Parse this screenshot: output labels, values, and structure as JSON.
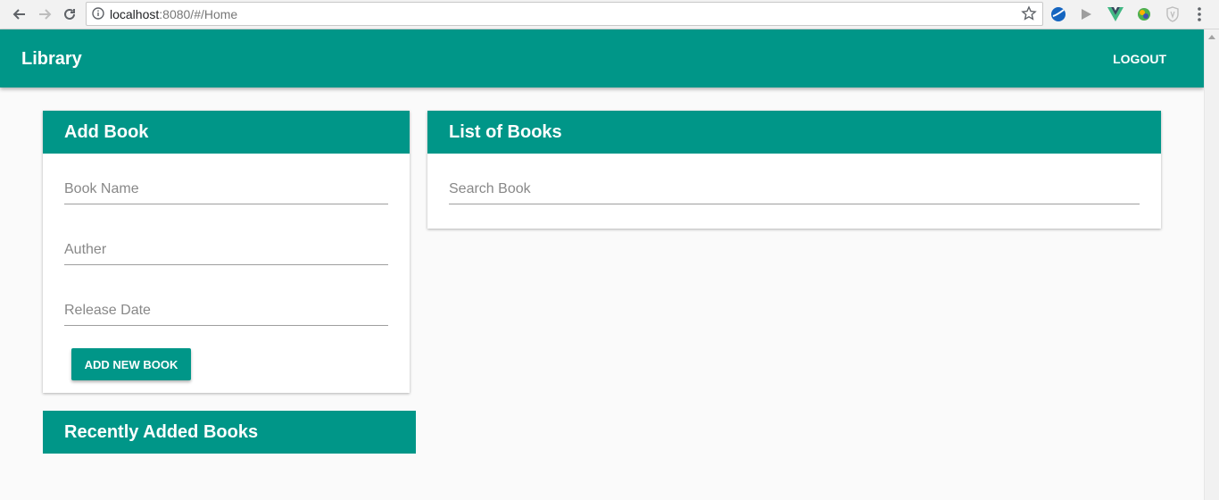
{
  "browser": {
    "url_host": "localhost",
    "url_rest": ":8080/#/Home"
  },
  "app": {
    "title": "Library",
    "logout_label": "LOGOUT"
  },
  "add_book": {
    "title": "Add Book",
    "book_name_placeholder": "Book Name",
    "author_placeholder": "Auther",
    "release_date_placeholder": "Release Date",
    "add_button_label": "ADD NEW BOOK"
  },
  "book_list": {
    "title": "List of Books",
    "search_placeholder": "Search Book"
  },
  "recent": {
    "title": "Recently Added Books"
  },
  "colors": {
    "primary": "#009688"
  }
}
